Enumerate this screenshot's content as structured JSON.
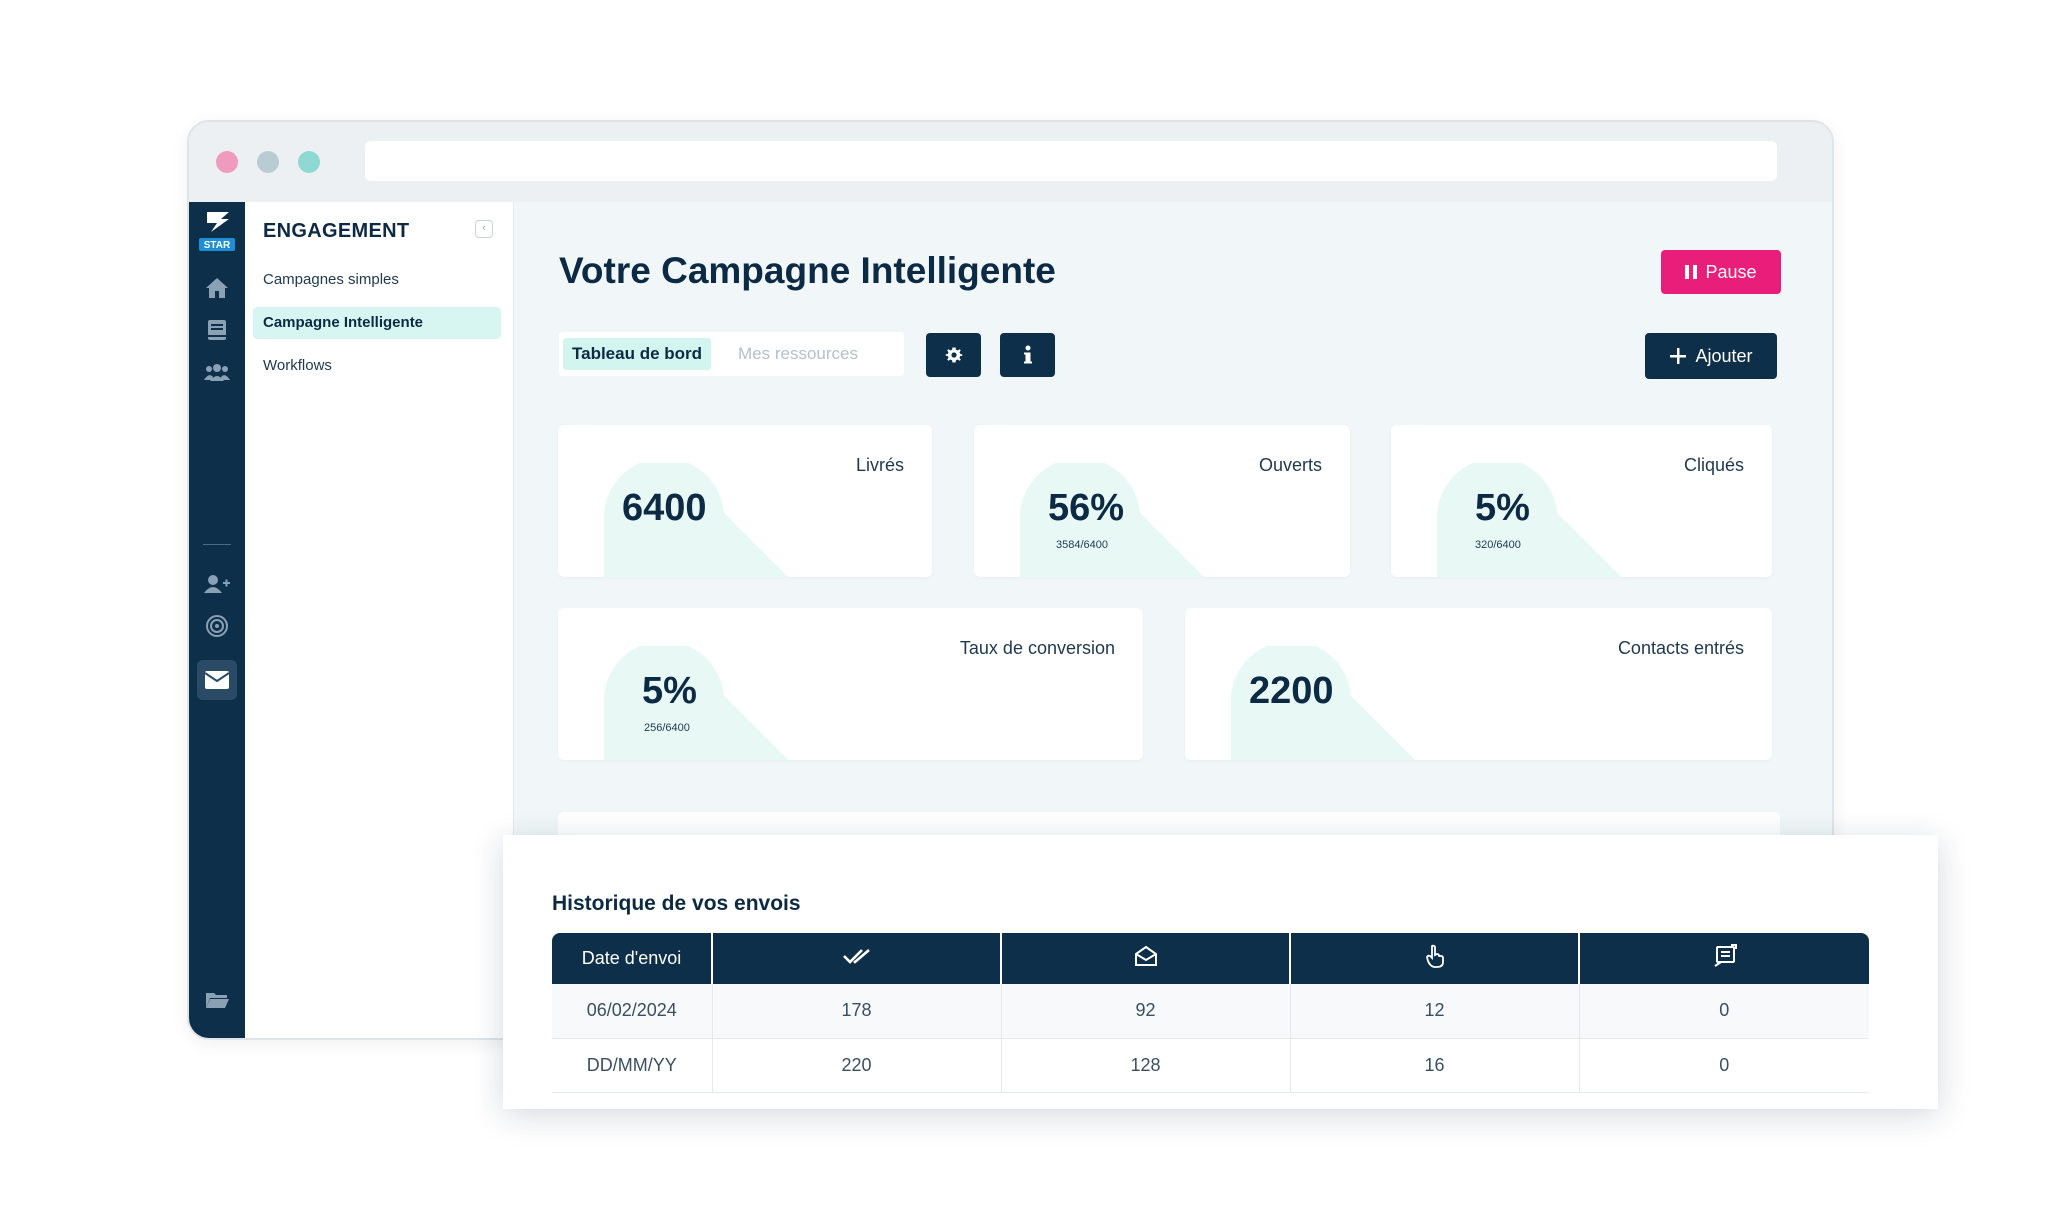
{
  "sidebar": {
    "logo_text": "STAR",
    "section_title": "ENGAGEMENT",
    "items": [
      {
        "label": "Campagnes simples",
        "active": false
      },
      {
        "label": "Campagne Intelligente",
        "active": true
      },
      {
        "label": "Workflows",
        "active": false
      }
    ],
    "rail_icons": [
      "home-icon",
      "book-icon",
      "users-icon",
      "add-user-icon",
      "target-icon",
      "mail-icon",
      "folder-icon",
      "gear-icon",
      "account-icon"
    ]
  },
  "header": {
    "title": "Votre Campagne Intelligente",
    "pause_label": "Pause",
    "tabs": [
      {
        "label": "Tableau de bord",
        "active": true
      },
      {
        "label": "Mes ressources",
        "active": false
      }
    ],
    "add_label": "Ajouter"
  },
  "stats": [
    {
      "label": "Livrés",
      "value": "6400",
      "sub": ""
    },
    {
      "label": "Ouverts",
      "value": "56%",
      "sub": "3584/6400"
    },
    {
      "label": "Cliqués",
      "value": "5%",
      "sub": "320/6400"
    },
    {
      "label": "Taux de conversion",
      "value": "5%",
      "sub": "256/6400"
    },
    {
      "label": "Contacts entrés",
      "value": "2200",
      "sub": ""
    }
  ],
  "history": {
    "title": "Historique de vos envois",
    "columns": [
      "Date d'envoi",
      "double-check-icon",
      "envelope-open-icon",
      "pointer-hand-icon",
      "reply-icon"
    ],
    "rows": [
      [
        "06/02/2024",
        "178",
        "92",
        "12",
        "0"
      ],
      [
        "DD/MM/YY",
        "220",
        "128",
        "16",
        "0"
      ]
    ]
  },
  "colors": {
    "navy": "#0e2f4a",
    "accent_pink": "#e91e7a",
    "mint": "#d3f5ef",
    "traffic_red": "#ef9bbd",
    "traffic_grey": "#b8cdd3",
    "traffic_teal": "#8fd9d4"
  }
}
